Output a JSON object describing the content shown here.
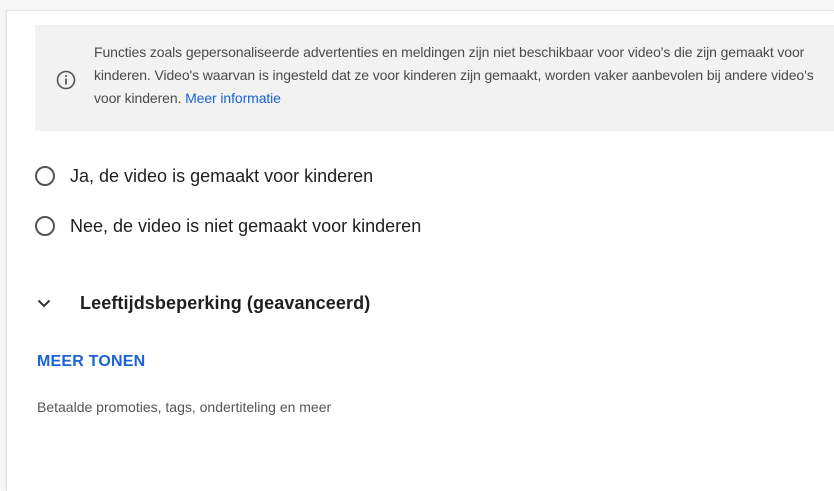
{
  "info": {
    "icon": "info-icon",
    "text": "Functies zoals gepersonaliseerde advertenties en meldingen zijn niet beschikbaar voor video's die zijn gemaakt voor kinderen. Video's waarvan is ingesteld dat ze voor kinderen zijn gemaakt, worden vaker aanbevolen bij andere video's voor kinderen. ",
    "link": "Meer informatie",
    "link_color": "#1a62d6"
  },
  "audience": {
    "options": [
      {
        "label": "Ja, de video is gemaakt voor kinderen",
        "selected": false
      },
      {
        "label": "Nee, de video is niet gemaakt voor kinderen",
        "selected": false
      }
    ]
  },
  "age_restriction": {
    "icon": "chevron-down-icon",
    "label": "Leeftijdsbeperking (geavanceerd)"
  },
  "more": {
    "button_label": "MEER TONEN",
    "description": "Betaalde promoties, tags, ondertiteling en meer"
  }
}
